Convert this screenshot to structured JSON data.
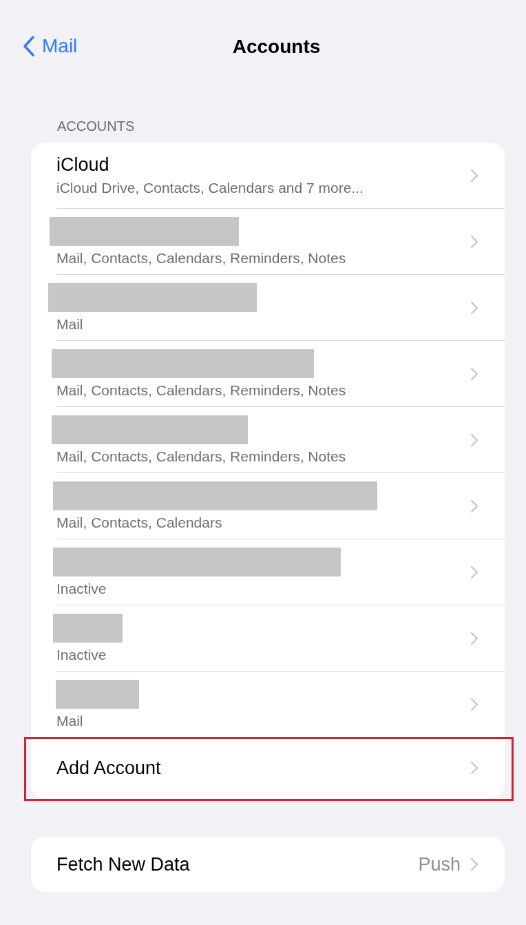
{
  "nav": {
    "back": "Mail",
    "title": "Accounts"
  },
  "section_header": "ACCOUNTS",
  "accounts": [
    {
      "title": "iCloud",
      "subtitle": "iCloud Drive, Contacts, Calendars and 7 more...",
      "redacted": false
    },
    {
      "subtitle": "Mail, Contacts, Calendars, Reminders, Notes",
      "redacted": true
    },
    {
      "subtitle": "Mail",
      "redacted": true
    },
    {
      "subtitle": "Mail, Contacts, Calendars, Reminders, Notes",
      "redacted": true
    },
    {
      "subtitle": "Mail, Contacts, Calendars, Reminders, Notes",
      "redacted": true
    },
    {
      "subtitle": "Mail, Contacts, Calendars",
      "redacted": true
    },
    {
      "subtitle": "Inactive",
      "redacted": true
    },
    {
      "subtitle": "Inactive",
      "redacted": true
    },
    {
      "subtitle": "Mail",
      "redacted": true
    }
  ],
  "add_account": {
    "label": "Add Account",
    "highlighted": true
  },
  "fetch": {
    "label": "Fetch New Data",
    "value": "Push"
  }
}
